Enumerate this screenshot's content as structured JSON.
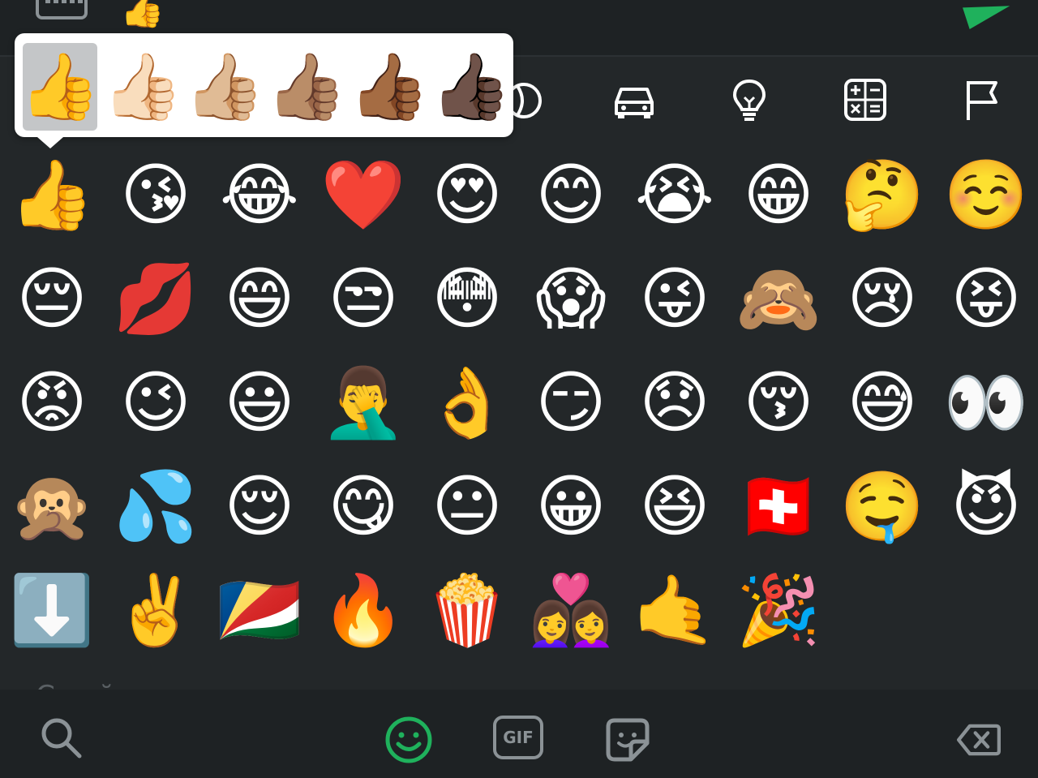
{
  "top": {
    "recent_emoji": "👍"
  },
  "skin_tones": [
    "👍",
    "👍🏻",
    "👍🏼",
    "👍🏽",
    "👍🏾",
    "👍🏿"
  ],
  "categories": [
    "sports-icon",
    "car-icon",
    "lightbulb-icon",
    "symbols-icon",
    "flag-icon"
  ],
  "emoji_rows": [
    [
      "👍",
      "😘",
      "😂",
      "❤️",
      "😍",
      "😊",
      "😭",
      "😁",
      "🤔",
      "☺️"
    ],
    [
      "😔",
      "💋",
      "😄",
      "😒",
      "😳",
      "😱",
      "😜",
      "🙈",
      "😢",
      "😝"
    ],
    [
      "😡",
      "😉",
      "😃",
      "🤦‍♂️",
      "👌",
      "😏",
      "😞",
      "😚",
      "😅",
      "👀"
    ],
    [
      "🙊",
      "💦",
      "😌",
      "😋",
      "😐",
      "😀",
      "😆",
      "🇨🇭",
      "🤤",
      "😈"
    ],
    [
      "⬇️",
      "✌️",
      "🇸🇨",
      "🔥",
      "🍿",
      "👩‍❤️‍👩",
      "🤙",
      "🎉"
    ]
  ],
  "section_label": "Смайлы и люди",
  "bottom": {
    "gif_label": "GIF"
  },
  "colors": {
    "background": "#232729",
    "accent": "#1fb15c",
    "icon": "#8b9296"
  }
}
